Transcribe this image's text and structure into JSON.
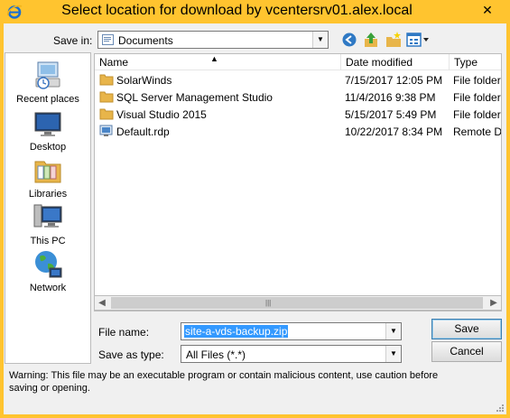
{
  "window": {
    "title": "Select location for download by vcentersrv01.alex.local",
    "close_icon": "close-icon"
  },
  "save_in": {
    "label": "Save in:",
    "value": "Documents"
  },
  "toolbar": {
    "back_icon": "back-arrow-icon",
    "up_icon": "up-folder-icon",
    "new_folder_icon": "new-folder-icon",
    "view_menu_icon": "view-menu-icon"
  },
  "places": [
    {
      "label": "Recent places",
      "icon": "recent-places-icon"
    },
    {
      "label": "Desktop",
      "icon": "desktop-icon"
    },
    {
      "label": "Libraries",
      "icon": "libraries-icon"
    },
    {
      "label": "This PC",
      "icon": "this-pc-icon"
    },
    {
      "label": "Network",
      "icon": "network-icon"
    }
  ],
  "file_list": {
    "columns": [
      "Name",
      "Date modified",
      "Type"
    ],
    "rows": [
      {
        "name": "SolarWinds",
        "date": "7/15/2017 12:05 PM",
        "type": "File folder",
        "icon": "folder-icon"
      },
      {
        "name": "SQL Server Management Studio",
        "date": "11/4/2016 9:38 PM",
        "type": "File folder",
        "icon": "folder-icon"
      },
      {
        "name": "Visual Studio 2015",
        "date": "5/15/2017 5:49 PM",
        "type": "File folder",
        "icon": "folder-icon"
      },
      {
        "name": "Default.rdp",
        "date": "10/22/2017 8:34 PM",
        "type": "Remote D",
        "icon": "rdp-file-icon"
      }
    ]
  },
  "form": {
    "file_name_label": "File name:",
    "file_name_value": "site-a-vds-backup.zip",
    "save_as_type_label": "Save as type:",
    "save_as_type_value": "All Files (*.*)"
  },
  "buttons": {
    "save": "Save",
    "cancel": "Cancel"
  },
  "warning": "Warning: This file may be an executable program or contain malicious content, use caution before saving or opening.",
  "colors": {
    "frame": "#ffc42f",
    "client": "#f0f0f0",
    "selection": "#3399ff",
    "folder": "#e8b54a"
  }
}
